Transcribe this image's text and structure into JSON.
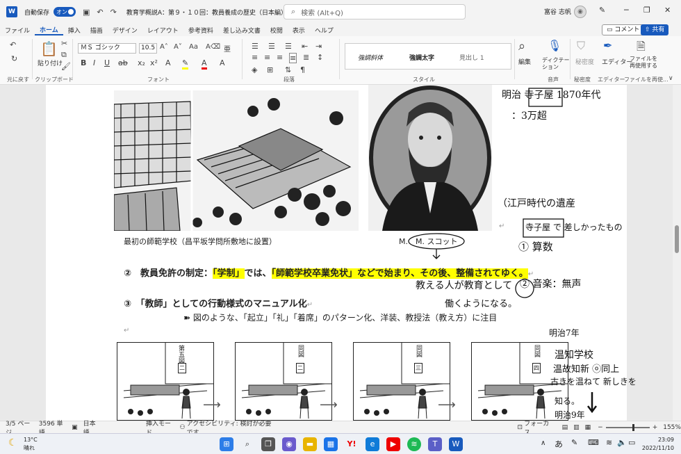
{
  "titlebar": {
    "autosave_label": "自動保存",
    "autosave_state": "オン",
    "doc_title": "教育学概説A：第９・１０回：教員養成の歴史（日本編） • 保存済み ∨",
    "search_placeholder": "検索 (Alt+Q)",
    "user_name": "富谷 志帆"
  },
  "menu": {
    "tabs": [
      "ファイル",
      "ホーム",
      "挿入",
      "描画",
      "デザイン",
      "レイアウト",
      "参考資料",
      "差し込み文書",
      "校閲",
      "表示",
      "ヘルプ"
    ],
    "active": "ホーム",
    "comment_label": "コメント",
    "share_label": "共有"
  },
  "ribbon": {
    "paste_label": "貼り付け",
    "font_name": "ＭＳ ゴシック",
    "font_size": "10.5",
    "style_items": [
      "強調斜体",
      "強調太字",
      "見出し 1"
    ],
    "edit_label": "編集",
    "dictate_label": "ディクテーション",
    "sensitivity_label": "秘密度",
    "editor_label": "エディター",
    "reuse_label": "ファイルを再使用する",
    "groups": {
      "undo": "元に戻す",
      "clipboard": "クリップボード",
      "font": "フォント",
      "paragraph": "段落",
      "style": "スタイル",
      "voice": "音声",
      "sensitivity": "秘密度",
      "editor": "エディター",
      "reuse": "ファイルを再使..."
    }
  },
  "document": {
    "caption_left": "最初の師範学校（昌平坂学問所敷地に設置）",
    "caption_right": "M.　M. スコット",
    "item2_prefix": "②　教員免許の制定：",
    "item2_hl1": "「学制」",
    "item2_mid": "では、",
    "item2_hl2": "「師範学校卒業免状」などで始まり、その後、整備されてゆく。",
    "item3": "③　「教師」としての行動様式のマニュアル化",
    "item3_sub": "➽ 図のような、「起立」「礼」「着席」のパターン化、洋装、教授法（教え方）に注目",
    "fig_labels": [
      "第五図",
      "同図",
      "同図",
      "同図"
    ],
    "fig_sublabels": [
      "二",
      "二",
      "三",
      "四"
    ],
    "para_mark": "↵"
  },
  "handwritten": {
    "notes": [
      "明治 寺子屋 1870年代",
      "：3万超",
      "（江戸時代の遺産",
      "寺子屋 で 差しかったもの",
      "① 算数",
      "教える人が教育として",
      "働くようになる。",
      "② 音楽：無声",
      "明治7年",
      "温知学校",
      "温故知新 ⓞ同上",
      "古きを温ねて 新しきを",
      "知る。",
      "明治9年"
    ]
  },
  "statusbar": {
    "page": "3/5 ページ",
    "words": "3596 単語",
    "language": "日本語",
    "insert_mode": "挿入モード",
    "accessibility": "アクセシビリティ: 検討が必要です",
    "focus": "フォーカス",
    "zoom": "155%"
  },
  "taskbar": {
    "temperature": "13°C",
    "weather": "晴れ",
    "ime": "あ",
    "time": "23:09",
    "date": "2022/11/10"
  }
}
